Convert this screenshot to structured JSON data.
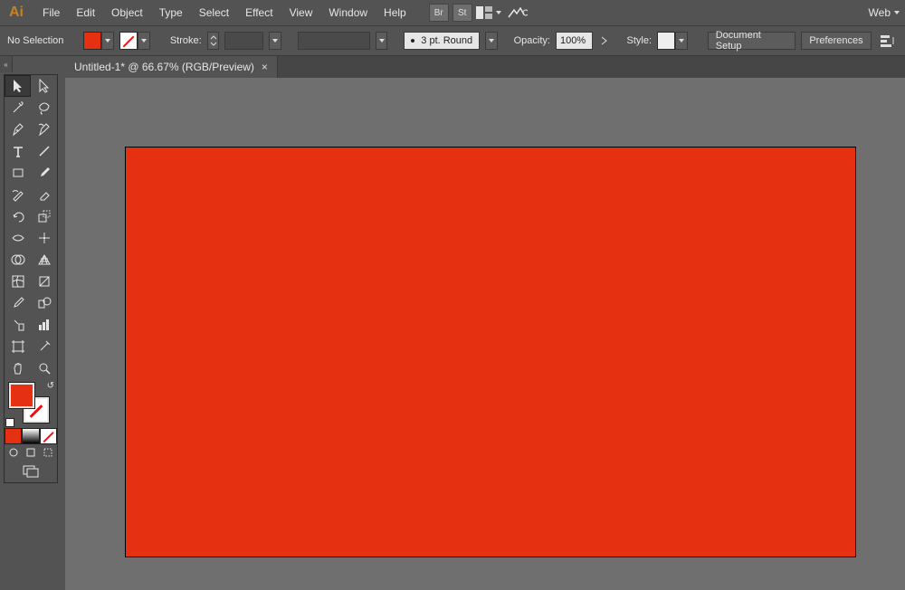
{
  "app": {
    "logo_text": "Ai"
  },
  "menu": {
    "items": [
      "File",
      "Edit",
      "Object",
      "Type",
      "Select",
      "Effect",
      "View",
      "Window",
      "Help"
    ],
    "bridge_label": "Br",
    "stock_label": "St",
    "workspace_label": "Web"
  },
  "options": {
    "selection_state": "No Selection",
    "fill_color": "#e53012",
    "stroke_label": "Stroke:",
    "stroke_weight": "",
    "brush_def": "",
    "stroke_profile": "3 pt. Round",
    "opacity_label": "Opacity:",
    "opacity_value": "100%",
    "style_label": "Style:",
    "doc_setup_label": "Document Setup",
    "prefs_label": "Preferences"
  },
  "tabs": [
    {
      "title": "Untitled-1* @ 66.67% (RGB/Preview)"
    }
  ],
  "tools": {
    "fill_color": "#e53012"
  }
}
